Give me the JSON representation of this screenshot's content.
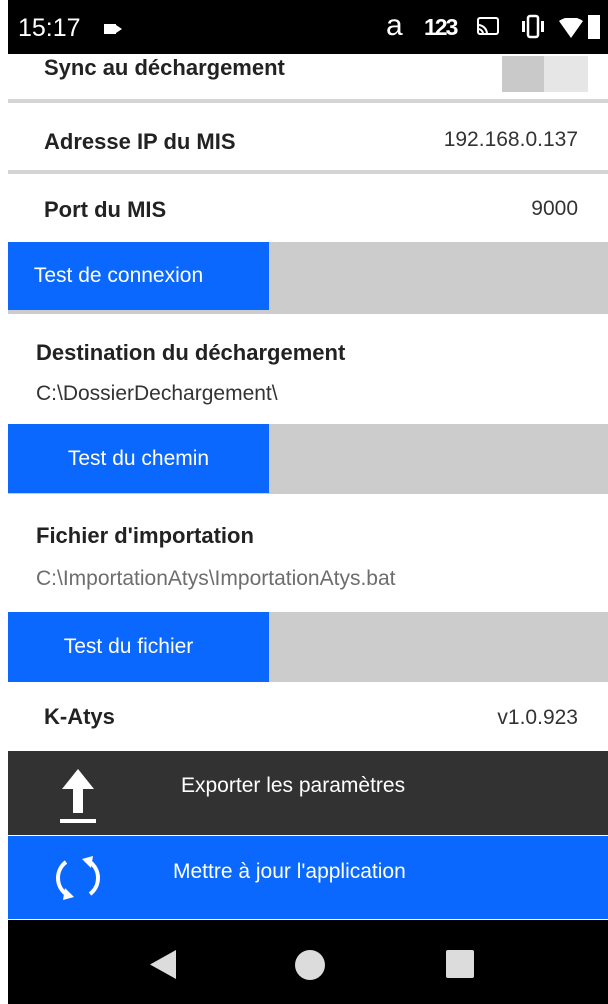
{
  "status_bar": {
    "time": "15:17",
    "a_glyph": "a",
    "keyboard_badge": "123",
    "icons": [
      "video-icon",
      "cast-icon",
      "vibrate-icon",
      "wifi-icon",
      "battery-icon"
    ]
  },
  "settings": {
    "sync": {
      "label": "Sync au déchargement",
      "enabled": false
    },
    "ip": {
      "label": "Adresse IP du MIS",
      "value": "192.168.0.137"
    },
    "port": {
      "label": "Port du MIS",
      "value": "9000"
    },
    "test_connection": "Test de connexion",
    "destination": {
      "label": "Destination du déchargement",
      "value": "C:\\DossierDechargement\\"
    },
    "test_path": "Test du chemin",
    "import_file": {
      "label": "Fichier d'importation",
      "value": "C:\\ImportationAtys\\ImportationAtys.bat"
    },
    "test_file": "Test du fichier",
    "app": {
      "label": "K-Atys",
      "version": "v1.0.923"
    }
  },
  "actions": {
    "export": {
      "label": "Exporter les paramètres",
      "icon": "upload-icon"
    },
    "update": {
      "label": "Mettre à jour l'application",
      "icon": "sync-icon"
    }
  },
  "nav": {
    "icons": [
      "back-icon",
      "home-icon",
      "recent-apps-icon"
    ]
  },
  "colors": {
    "accent": "#0a68ff",
    "dark_bar": "#323232",
    "gray_band": "#cccccc"
  }
}
